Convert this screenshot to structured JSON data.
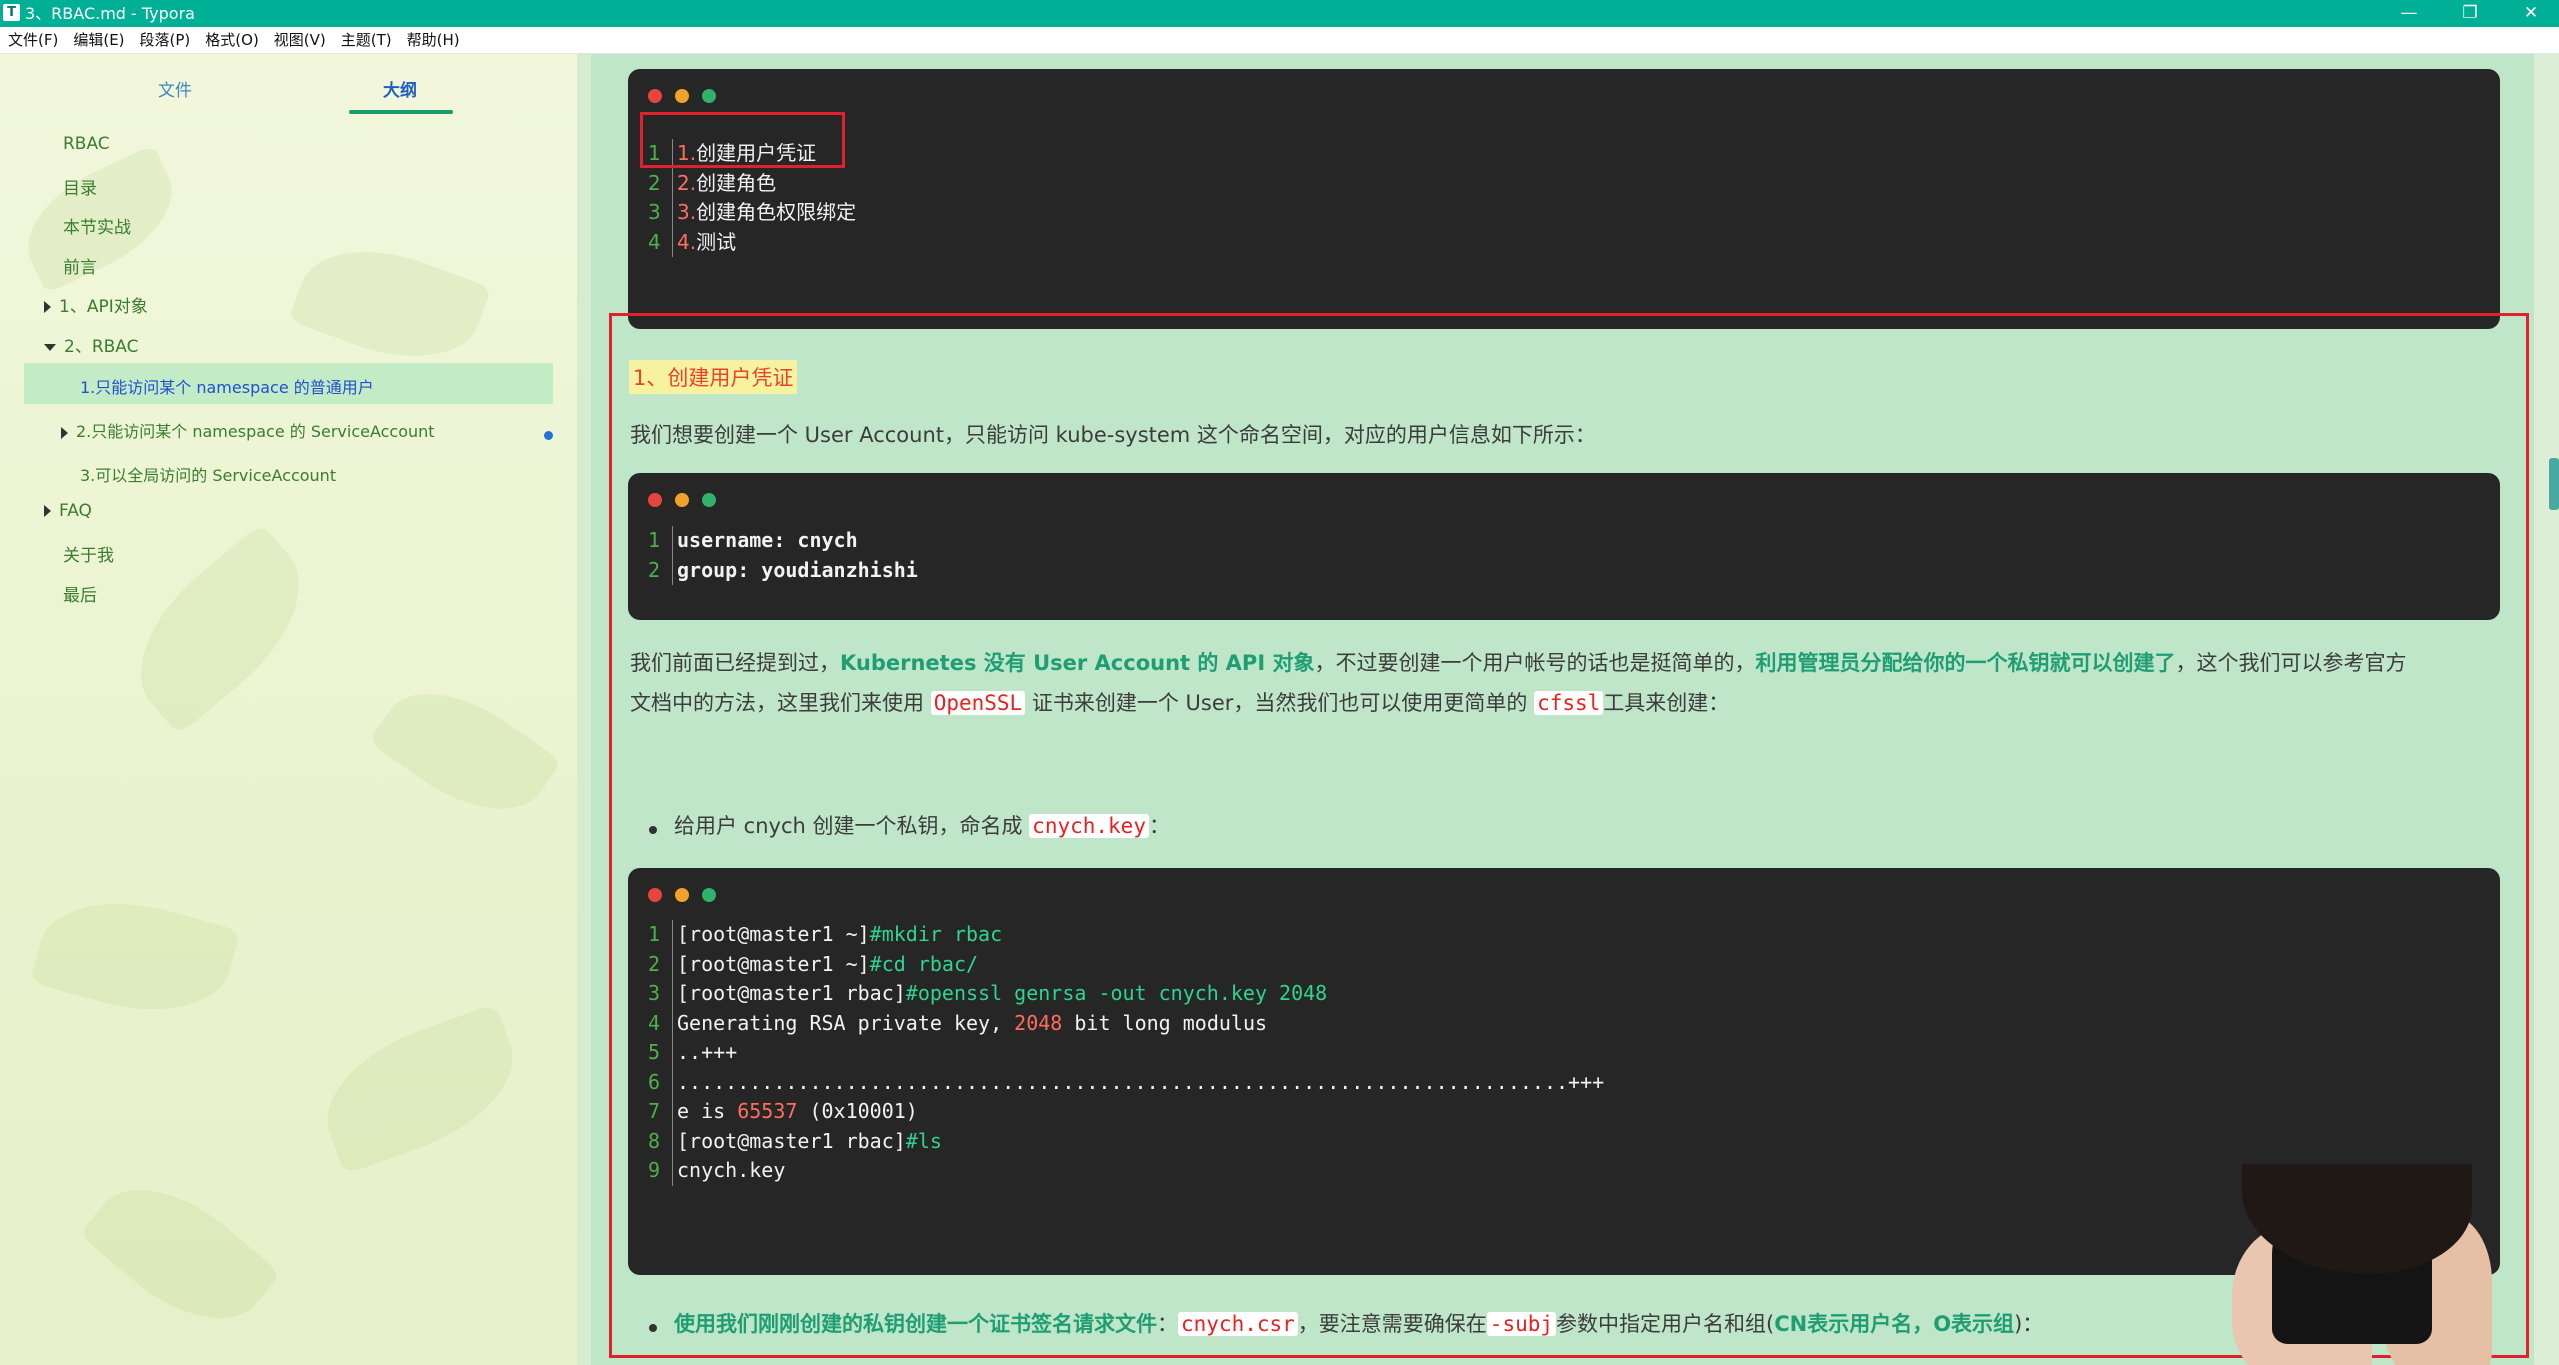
{
  "window": {
    "app_icon": "T",
    "title": "3、RBAC.md - Typora",
    "controls": {
      "minimize": "—",
      "maximize": "❐",
      "close": "✕"
    }
  },
  "menu": [
    "文件(F)",
    "编辑(E)",
    "段落(P)",
    "格式(O)",
    "视图(V)",
    "主题(T)",
    "帮助(H)"
  ],
  "sidebar": {
    "tabs": {
      "files": "文件",
      "outline": "大纲"
    },
    "outline": [
      {
        "label": "RBAC"
      },
      {
        "label": "目录"
      },
      {
        "label": "本节实战"
      },
      {
        "label": "前言"
      },
      {
        "label": "1、API对象"
      },
      {
        "label": "2、RBAC"
      },
      {
        "label": "1.只能访问某个 namespace 的普通用户",
        "active": true
      },
      {
        "label": "2.只能访问某个 namespace 的 ServiceAccount"
      },
      {
        "label": "3.可以全局访问的 ServiceAccount"
      },
      {
        "label": "FAQ"
      },
      {
        "label": "关于我"
      },
      {
        "label": "最后"
      }
    ]
  },
  "doc": {
    "toc_block": {
      "lines": [
        {
          "n": "1",
          "num": "1.",
          "text": "创建用户凭证"
        },
        {
          "n": "2",
          "num": "2.",
          "text": "创建角色"
        },
        {
          "n": "3",
          "num": "3.",
          "text": "创建角色权限绑定"
        },
        {
          "n": "4",
          "num": "4.",
          "text": "测试"
        }
      ]
    },
    "heading": "1、创建用户凭证",
    "p1": "我们想要创建一个 User Account，只能访问 kube-system 这个命名空间，对应的用户信息如下所示：",
    "user_block": {
      "lines": [
        {
          "n": "1",
          "text": "username: cnych"
        },
        {
          "n": "2",
          "text": "group: youdianzhishi"
        }
      ]
    },
    "p2": {
      "s1": "我们前面已经提到过，",
      "h1": "Kubernetes 没有 User Account 的 API 对象",
      "s2": "，不过要创建一个用户帐号的话也是挺简单的，",
      "h2": "利用管理员分配给你的一个私钥就可以创建了",
      "s3": "，这个我们可以参考官方",
      "s4": "文档中的方法，这里我们来使用 ",
      "c1": "OpenSSL",
      "s5": " 证书来创建一个 User，当然我们也可以使用更简单的 ",
      "c2": "cfssl",
      "s6": "工具来创建："
    },
    "bullet1": {
      "text": "给用户 cnych 创建一个私钥，命名成 ",
      "code": "cnych.key",
      "tail": "："
    },
    "shell_block": {
      "lines": [
        {
          "n": "1",
          "prompt": "[root@master1 ~]",
          "cmd": "#mkdir rbac"
        },
        {
          "n": "2",
          "prompt": "[root@master1 ~]",
          "cmd": "#cd rbac/"
        },
        {
          "n": "3",
          "prompt": "[root@master1 rbac]",
          "cmd": "#openssl genrsa -out cnych.key 2048"
        },
        {
          "n": "4",
          "pre": "Generating RSA private key, ",
          "num": "2048",
          "post": " bit long modulus"
        },
        {
          "n": "5",
          "pre": "..+++"
        },
        {
          "n": "6",
          "pre": "..........................................................................+++"
        },
        {
          "n": "7",
          "pre": "e is ",
          "num": "65537",
          "post": " (0x10001)"
        },
        {
          "n": "8",
          "prompt": "[root@master1 rbac]",
          "cmd": "#ls"
        },
        {
          "n": "9",
          "pre": "cnych.key"
        }
      ]
    },
    "bullet2": {
      "h": "使用我们刚刚创建的私钥创建一个证书签名请求文件",
      "s1": "：",
      "c1": "cnych.csr",
      "s2": "，要注意需要确保在",
      "c2": "-subj",
      "s3": "参数中指定用户名和组(",
      "h2": "CN表示用户名，O表示组",
      "s4": ")："
    }
  },
  "colors": {
    "titlebar": "#00b096",
    "editor_bg": "#bfe6c9",
    "code_bg": "#262626",
    "highlight_red": "#e0202b",
    "emphasis_green": "#1f9e74"
  }
}
